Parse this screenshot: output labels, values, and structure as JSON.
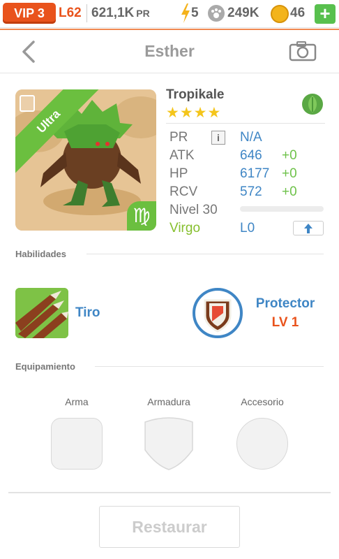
{
  "topbar": {
    "vip_label": "VIP 3",
    "level_label": "L62",
    "pr_value": "621,1K",
    "pr_unit": "PR",
    "energy_value": "5",
    "paw_value": "249K",
    "coins_value": "46",
    "plus_label": "+"
  },
  "header": {
    "title": "Esther",
    "back_icon": "chevron-left-icon",
    "camera_icon": "camera-icon"
  },
  "monster": {
    "rarity": "Ultra",
    "name": "Tropikale",
    "stars": "★★★★",
    "element_icon": "leaf-icon",
    "zodiac_symbol": "♍"
  },
  "stats": {
    "pr_label": "PR",
    "pr_value": "N/A",
    "info_label": "i",
    "atk_label": "ATK",
    "atk_value": "646",
    "atk_bonus": "+0",
    "hp_label": "HP",
    "hp_value": "6177",
    "hp_bonus": "+0",
    "rcv_label": "RCV",
    "rcv_value": "572",
    "rcv_bonus": "+0",
    "level_label": "Nivel 30",
    "level_progress": 0,
    "zodiac_label": "Virgo",
    "zodiac_level": "L0",
    "upgrade_icon": "arrow-up-icon"
  },
  "abilities": {
    "section_label": "Habilidades",
    "skill1_name": "Tiro",
    "skill2_name": "Protector",
    "skill2_level": "LV 1"
  },
  "equipment": {
    "section_label": "Equipamiento",
    "weapon_label": "Arma",
    "armor_label": "Armadura",
    "accessory_label": "Accesorio"
  },
  "footer": {
    "restore_label": "Restaurar"
  },
  "colors": {
    "accent_orange": "#e9531c",
    "value_blue": "#3f86c5",
    "bonus_green": "#6ec24a",
    "star_yellow": "#f4c51b",
    "ribbon_green": "#6bbf3f"
  }
}
